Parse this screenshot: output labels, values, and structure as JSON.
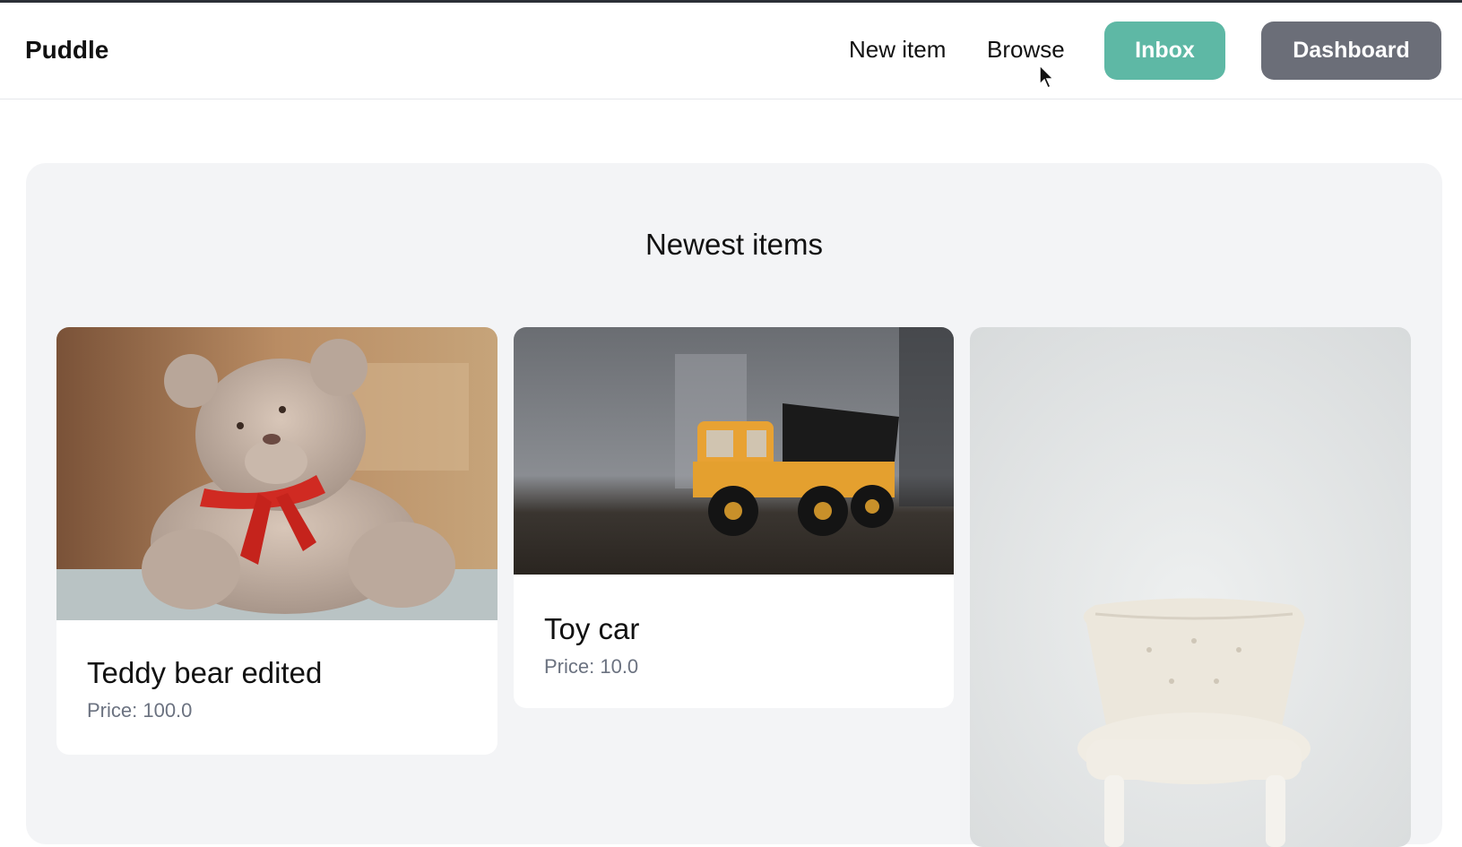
{
  "nav": {
    "brand": "Puddle",
    "links": {
      "new_item": "New item",
      "browse": "Browse"
    },
    "buttons": {
      "inbox": "Inbox",
      "dashboard": "Dashboard"
    },
    "colors": {
      "inbox": "#5eb8a5",
      "dashboard": "#6b6e78"
    }
  },
  "main": {
    "title": "Newest items",
    "items": [
      {
        "name": "Teddy bear edited",
        "price": "Price: 100.0",
        "image": "teddy-bear-photo"
      },
      {
        "name": "Toy car",
        "price": "Price: 10.0",
        "image": "toy-truck-photo"
      },
      {
        "name": "",
        "price": "",
        "image": "white-chair-photo"
      }
    ]
  }
}
